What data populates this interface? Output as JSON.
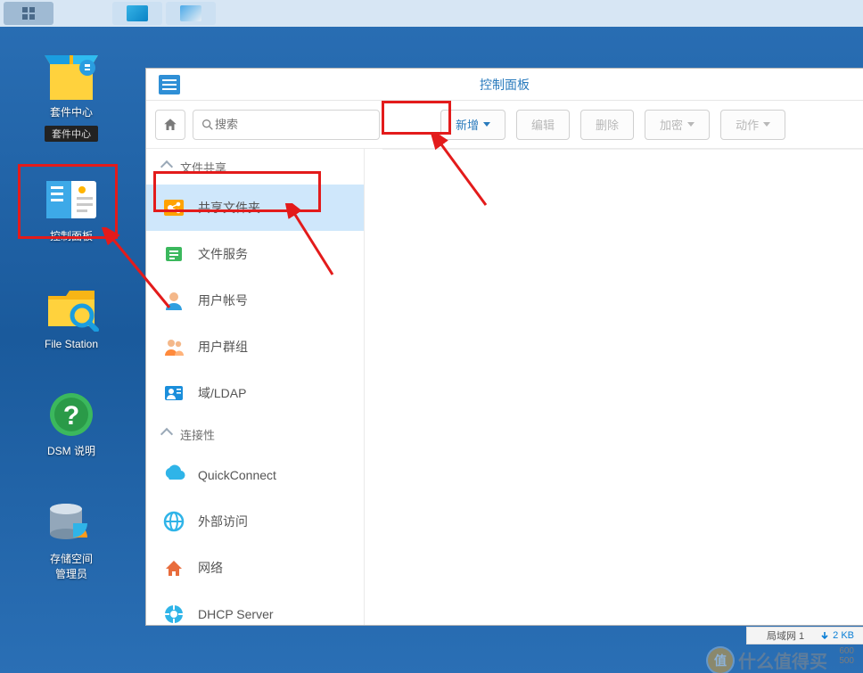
{
  "taskbar": {
    "items": [
      "launcher",
      "search",
      "control-panel"
    ]
  },
  "desktop": {
    "icons": [
      {
        "id": "package-center",
        "label": "套件中心",
        "tooltip": "套件中心"
      },
      {
        "id": "control-panel",
        "label": "控制面板"
      },
      {
        "id": "file-station",
        "label": "File Station"
      },
      {
        "id": "dsm-help",
        "label": "DSM 说明"
      },
      {
        "id": "storage-manager",
        "label": "存储空间\n管理员"
      }
    ]
  },
  "window": {
    "title": "控制面板",
    "search_placeholder": "搜索",
    "buttons": {
      "new": "新增",
      "edit": "编辑",
      "delete": "删除",
      "encrypt": "加密",
      "action": "动作"
    },
    "sections": {
      "file_sharing": "文件共享",
      "connectivity": "连接性"
    },
    "sidebar": {
      "file_sharing": [
        {
          "id": "shared-folder",
          "label": "共享文件夹"
        },
        {
          "id": "file-services",
          "label": "文件服务"
        },
        {
          "id": "user",
          "label": "用户帐号"
        },
        {
          "id": "group",
          "label": "用户群组"
        },
        {
          "id": "domain-ldap",
          "label": "域/LDAP"
        }
      ],
      "connectivity": [
        {
          "id": "quickconnect",
          "label": "QuickConnect"
        },
        {
          "id": "external-access",
          "label": "外部访问"
        },
        {
          "id": "network",
          "label": "网络"
        },
        {
          "id": "dhcp-server",
          "label": "DHCP Server"
        }
      ]
    }
  },
  "footer": {
    "lan_label": "局域网 1",
    "down_speed": "2 KB",
    "numbers": [
      "600",
      "500"
    ]
  },
  "watermark": {
    "badge": "值",
    "text": "什么值得买"
  }
}
